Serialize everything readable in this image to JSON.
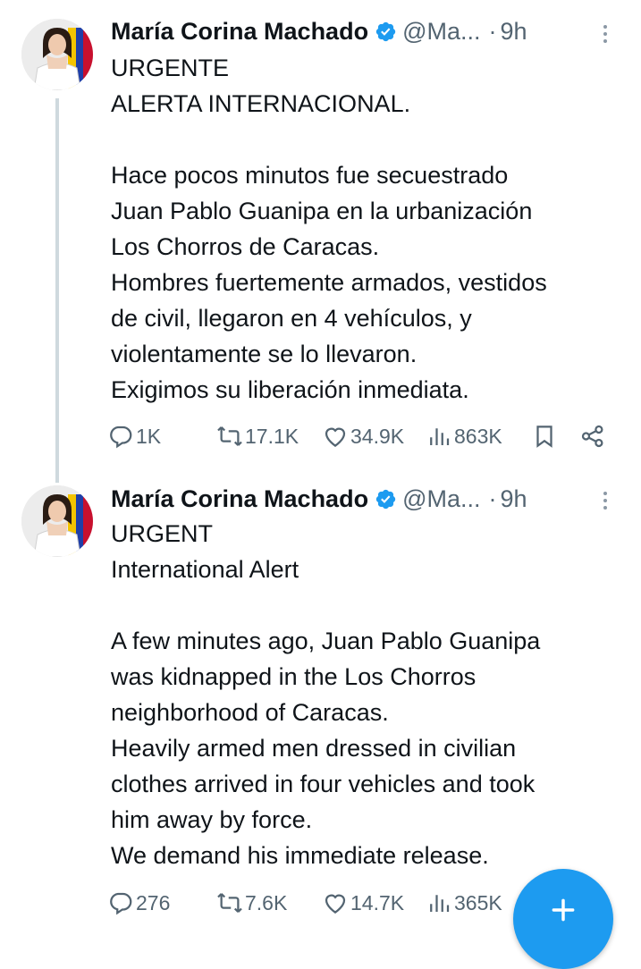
{
  "tweets": [
    {
      "author": "María Corina Machado",
      "handle": "@Ma...",
      "separator": "·",
      "time": "9h",
      "lines": [
        "URGENTE",
        "ALERTA INTERNACIONAL.",
        "",
        "Hace pocos minutos fue secuestrado",
        "Juan Pablo Guanipa en la urbanización",
        "Los Chorros de Caracas.",
        "Hombres fuertemente armados, vestidos",
        "de civil, llegaron en 4 vehículos, y",
        "violentamente se lo llevaron.",
        "Exigimos su liberación inmediata."
      ],
      "stats": {
        "replies": "1K",
        "reposts": "17.1K",
        "likes": "34.9K",
        "views": "863K"
      }
    },
    {
      "author": "María Corina Machado",
      "handle": "@Ma...",
      "separator": "·",
      "time": "9h",
      "lines": [
        "URGENT",
        "International Alert",
        "",
        "A few minutes ago, Juan Pablo Guanipa",
        "was kidnapped in the Los Chorros",
        "neighborhood of Caracas.",
        "Heavily armed men dressed in civilian",
        "clothes arrived in four vehicles and took",
        "him away by force.",
        "We demand his immediate release."
      ],
      "stats": {
        "replies": "276",
        "reposts": "7.6K",
        "likes": "14.7K",
        "views": "365K"
      }
    }
  ],
  "icons": {
    "verified": "verified-badge-icon",
    "reply": "reply-icon",
    "repost": "repost-icon",
    "like": "like-icon",
    "views": "views-icon",
    "bookmark": "bookmark-icon",
    "share": "share-icon",
    "more": "more-options-icon",
    "compose": "compose-plus-icon"
  },
  "colors": {
    "text": "#0f1419",
    "muted": "#536471",
    "verified": "#1d9bf0",
    "fab": "#1d9bf0",
    "thread_line": "#cfd9de"
  }
}
